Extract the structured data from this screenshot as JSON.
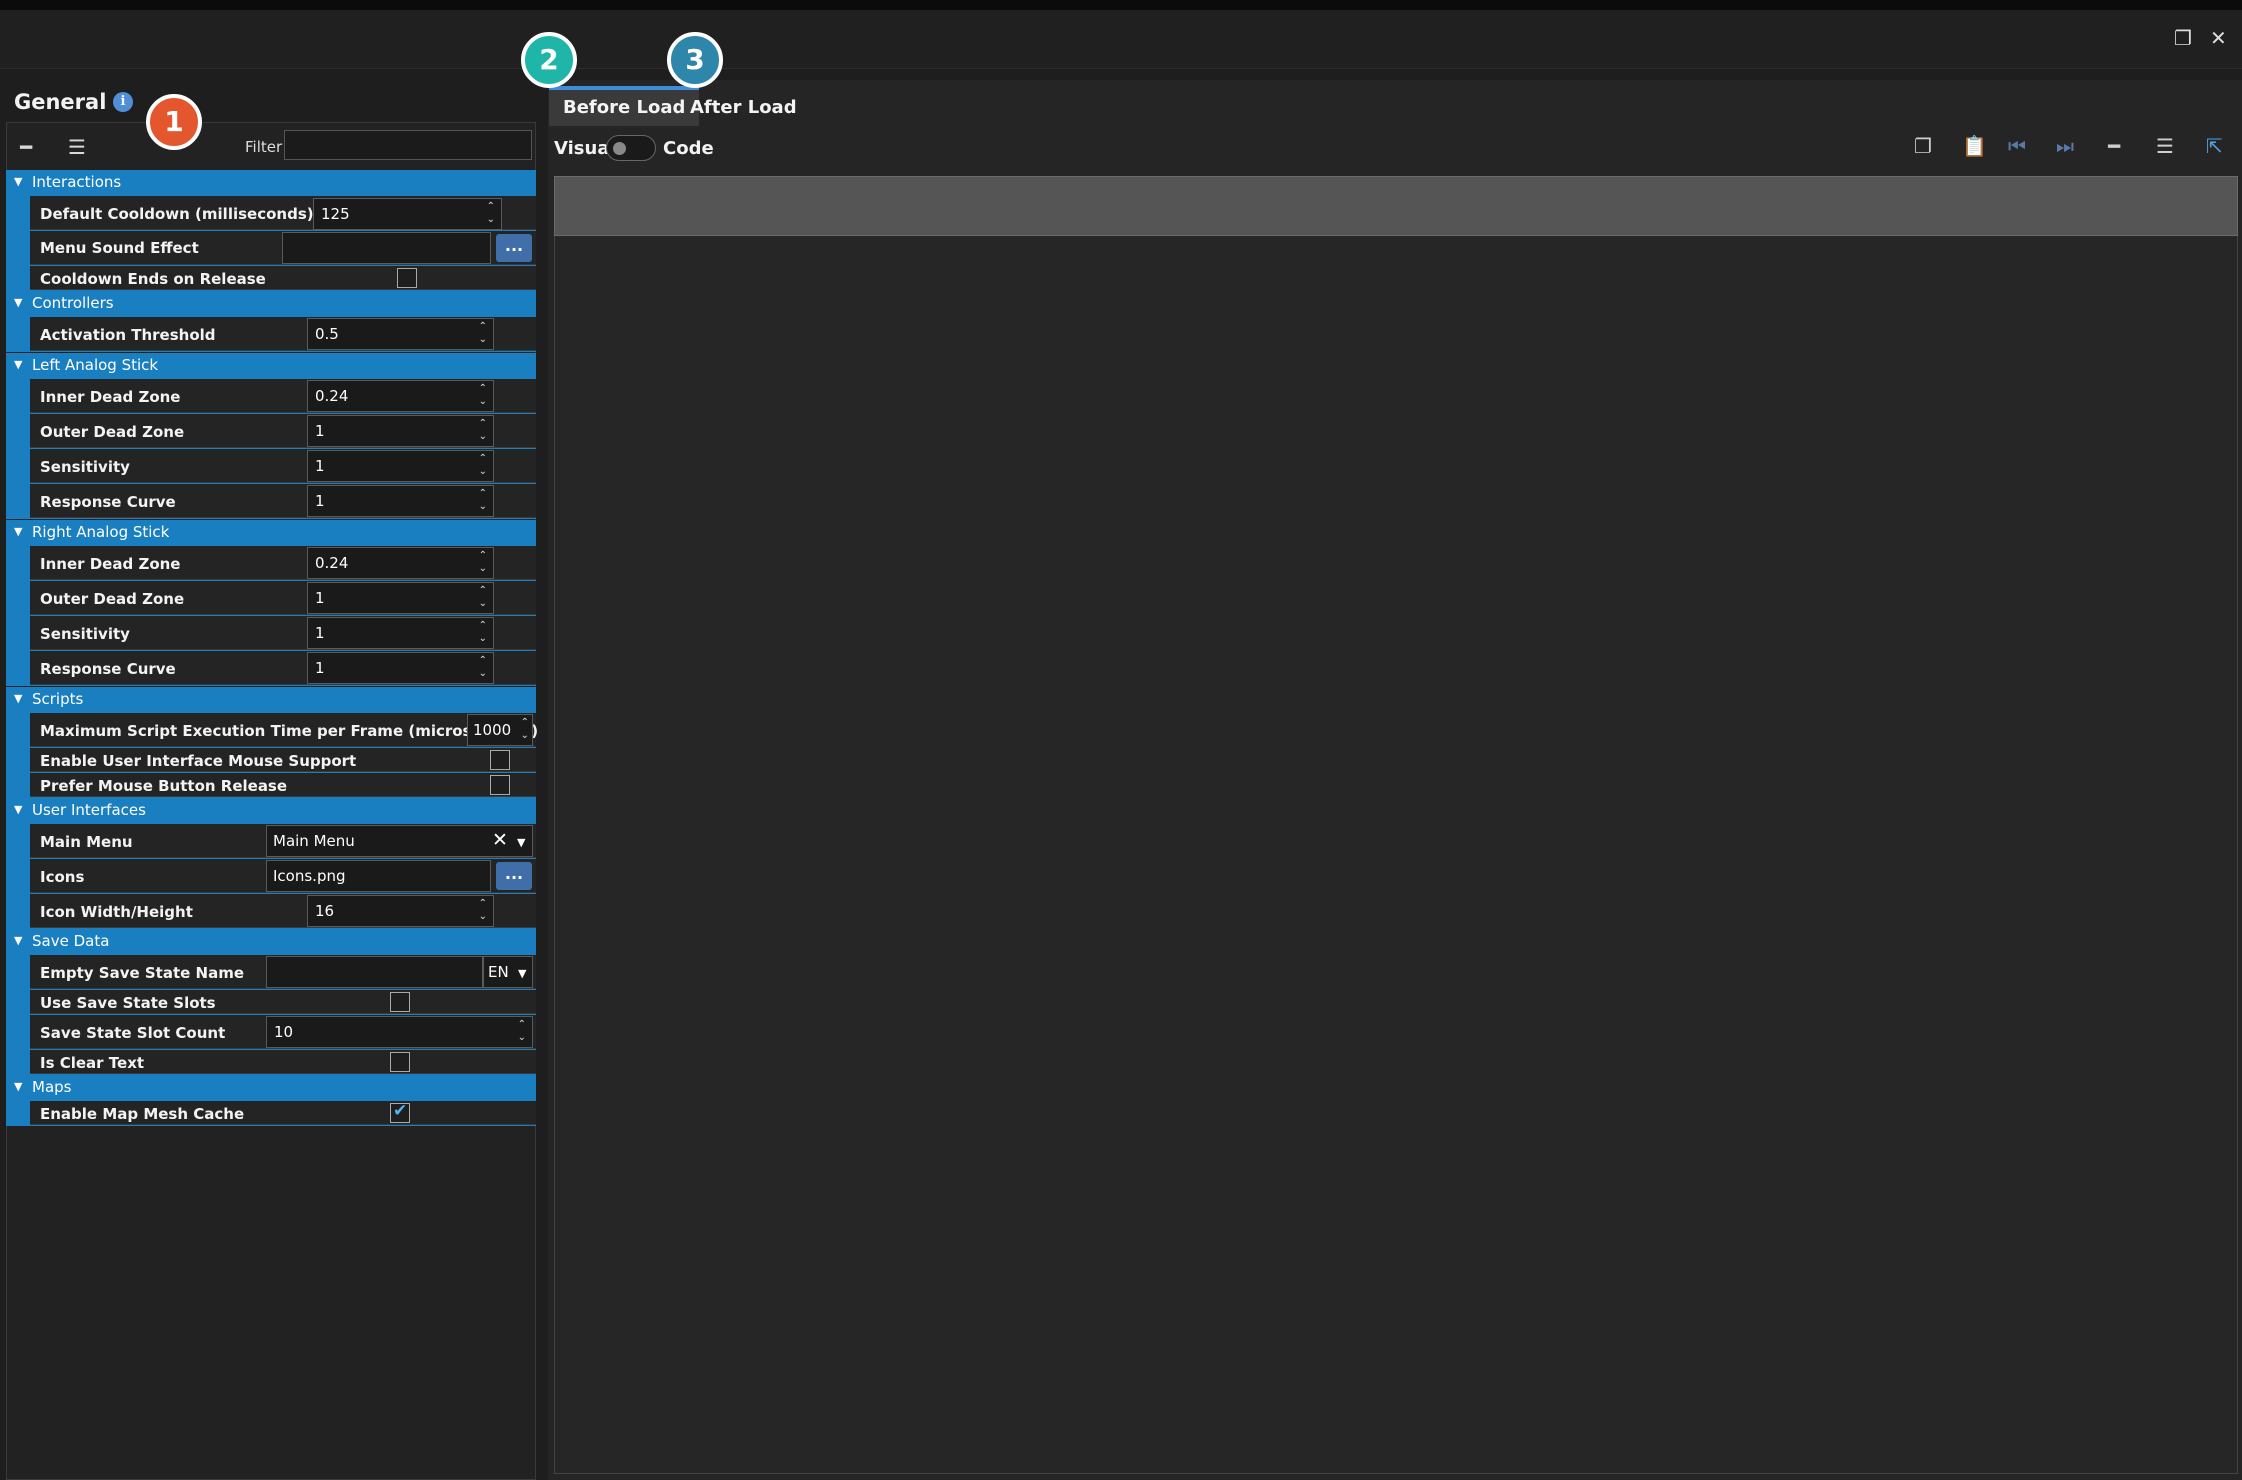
{
  "window": {
    "restore_icon": "restore-icon",
    "close_icon": "close-icon"
  },
  "left": {
    "title": "General",
    "filter_label": "Filter",
    "filter_value": "",
    "sections": [
      {
        "name": "Interactions"
      },
      {
        "name": "Controllers"
      },
      {
        "name": "Left Analog Stick"
      },
      {
        "name": "Right Analog Stick"
      },
      {
        "name": "Scripts"
      },
      {
        "name": "User Interfaces"
      },
      {
        "name": "Save Data"
      },
      {
        "name": "Maps"
      }
    ],
    "props": {
      "default_cooldown": {
        "label": "Default Cooldown (milliseconds)",
        "value": "125"
      },
      "menu_sound": {
        "label": "Menu Sound Effect",
        "value": "",
        "button": "..."
      },
      "cooldown_release": {
        "label": "Cooldown Ends on Release",
        "checked": false
      },
      "activation_threshold": {
        "label": "Activation Threshold",
        "value": "0.5"
      },
      "l_inner": {
        "label": "Inner Dead Zone",
        "value": "0.24"
      },
      "l_outer": {
        "label": "Outer Dead Zone",
        "value": "1"
      },
      "l_sens": {
        "label": "Sensitivity",
        "value": "1"
      },
      "l_curve": {
        "label": "Response Curve",
        "value": "1"
      },
      "r_inner": {
        "label": "Inner Dead Zone",
        "value": "0.24"
      },
      "r_outer": {
        "label": "Outer Dead Zone",
        "value": "1"
      },
      "r_sens": {
        "label": "Sensitivity",
        "value": "1"
      },
      "r_curve": {
        "label": "Response Curve",
        "value": "1"
      },
      "max_script": {
        "label": "Maximum Script Execution Time per Frame (microseconds)",
        "value": "1000"
      },
      "ui_mouse": {
        "label": "Enable User Interface Mouse Support",
        "checked": false
      },
      "mouse_release": {
        "label": "Prefer Mouse Button Release",
        "checked": false
      },
      "main_menu": {
        "label": "Main Menu",
        "value": "Main Menu"
      },
      "icons": {
        "label": "Icons",
        "value": "Icons.png",
        "button": "..."
      },
      "icon_size": {
        "label": "Icon Width/Height",
        "value": "16"
      },
      "empty_save": {
        "label": "Empty Save State Name",
        "value": "",
        "lang": "EN"
      },
      "use_slots": {
        "label": "Use Save State Slots",
        "checked": false
      },
      "slot_count": {
        "label": "Save State Slot Count",
        "value": "10"
      },
      "clear_text": {
        "label": "Is Clear Text",
        "checked": false
      },
      "map_cache": {
        "label": "Enable Map Mesh Cache",
        "checked": true
      }
    }
  },
  "right": {
    "tabs": [
      "Before Load",
      "After Load"
    ],
    "active_tab": "Before Load",
    "visual_label": "Visual",
    "code_label": "Code"
  },
  "badges": [
    "1",
    "2",
    "3"
  ],
  "colors": {
    "accent": "#1a7fc1",
    "badge1": "#e4572e",
    "badge2": "#1fb5a8",
    "badge3": "#2e86ab"
  }
}
